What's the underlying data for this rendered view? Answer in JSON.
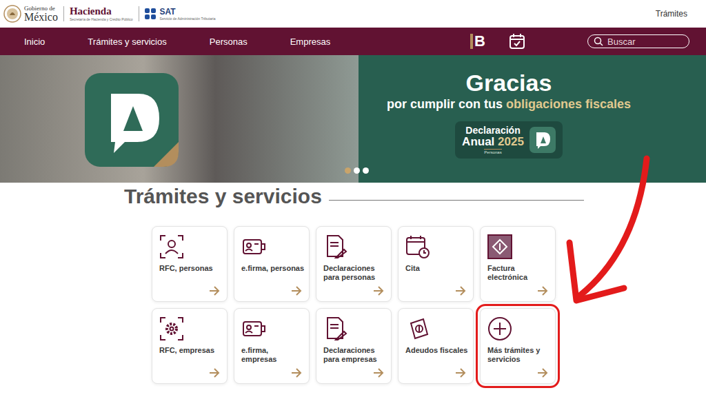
{
  "header": {
    "gov_logo": {
      "line1": "Gobierno de",
      "line2": "México"
    },
    "hacienda": {
      "title": "Hacienda",
      "subtitle": "Secretaría de Hacienda y Crédito Público"
    },
    "sat": {
      "title": "SAT",
      "subtitle": "Servicio de Administración Tributaria"
    },
    "link": "Trámites"
  },
  "nav": {
    "items": [
      "Inicio",
      "Trámites y servicios",
      "Personas",
      "Empresas"
    ],
    "brand_mark": "B",
    "search": {
      "placeholder": "Buscar"
    }
  },
  "banner": {
    "title": "Gracias",
    "subtitle": "por cumplir con tus",
    "highlight": "obligaciones fiscales",
    "badge": {
      "line1": "Declaración",
      "line2": "Anual",
      "year": "2025",
      "caption": "Personas"
    },
    "dots": [
      {
        "selected": true
      },
      {
        "selected": false
      },
      {
        "selected": false
      }
    ]
  },
  "section": {
    "title": "Trámites y servicios",
    "cards": [
      {
        "label": "RFC, personas",
        "highlighted": false
      },
      {
        "label": "e.firma, personas",
        "highlighted": false
      },
      {
        "label": "Declaraciones para personas",
        "highlighted": false
      },
      {
        "label": "Cita",
        "highlighted": false
      },
      {
        "label": "Factura electrónica",
        "highlighted": false
      },
      {
        "label": "RFC, empresas",
        "highlighted": false
      },
      {
        "label": "e.firma, empresas",
        "highlighted": false
      },
      {
        "label": "Declaraciones para empresas",
        "highlighted": false
      },
      {
        "label": "Adeudos fiscales",
        "highlighted": false
      },
      {
        "label": "Más trámites y servicios",
        "highlighted": true
      }
    ]
  }
}
